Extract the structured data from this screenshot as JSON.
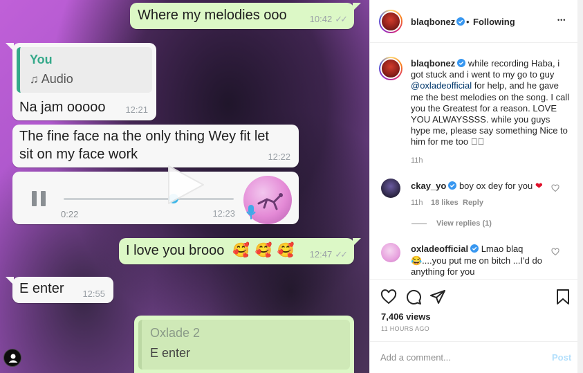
{
  "chat": {
    "msg1": {
      "text": "Where my melodies ooo",
      "time": "10:42"
    },
    "msg2": {
      "quote_name": "You",
      "quote_sub": "Audio",
      "text": "Na jam ooooo",
      "time": "12:21"
    },
    "msg3": {
      "line1": "The fine face na the only thing Wey fit let",
      "line2": "sit on my face work",
      "time": "12:22"
    },
    "audio": {
      "elapsed": "0:22",
      "time": "12:23",
      "progress": 0.6
    },
    "msg4": {
      "text": "I love you brooo",
      "emoji": "🥰 🥰 🥰",
      "time": "12:47"
    },
    "msg5": {
      "text": "E enter",
      "time": "12:55"
    },
    "msg6": {
      "quote_name": "Oxlade 2",
      "text": "E enter"
    }
  },
  "post": {
    "header": {
      "username": "blaqbonez",
      "follow_state": "Following",
      "dot": "•",
      "more": "•••"
    },
    "caption": {
      "username": "blaqbonez",
      "text_before": "while recording Haba, i got stuck and i went to my go to guy",
      "mention": "@oxladeofficial",
      "text_after": "for help, and he gave me the best melodies on the song. I call you the Greatest for a reason. LOVE YOU ALWAYSSSS. while you guys hype me, please say something Nice to him for me too",
      "emoji_tail": "🏾🏾",
      "age": "11h"
    },
    "comments": [
      {
        "username": "ckay_yo",
        "text": "boy ox dey for you",
        "age": "11h",
        "likes": "18 likes",
        "reply": "Reply",
        "view_replies": "View replies (1)"
      },
      {
        "username": "oxladeofficial",
        "text_line1": "Lmao blaq",
        "text_line2": "😂....you put me on bitch ...I'd do",
        "text_line3": "anything for you"
      }
    ],
    "views": "7,406 views",
    "timestamp": "11 HOURS AGO",
    "comment_placeholder": "Add a comment...",
    "post_button": "Post"
  },
  "colors": {
    "ig_blue": "#0095f6",
    "verified": "#3897f0",
    "wa_in": "#f7f7f7",
    "wa_out": "#dcf8c6",
    "accent_green": "#35a98a"
  }
}
